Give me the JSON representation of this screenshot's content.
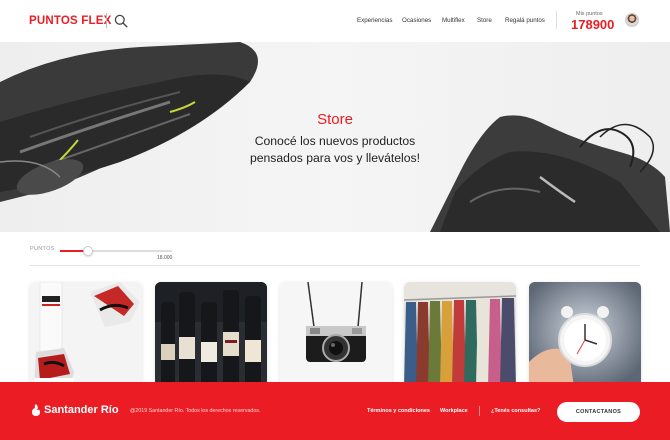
{
  "header": {
    "logo": "PUNTOS FLEX",
    "nav": [
      "Experiencias",
      "Ocasiones",
      "Multiflex",
      "Store",
      "Regalá puntos"
    ],
    "points_label": "Mis puntos",
    "points_value": "178900"
  },
  "hero": {
    "title": "Store",
    "subtitle": "Conocé los nuevos productos pensados para vos y llevátelos!"
  },
  "filter": {
    "label": "PUNTOS",
    "max_value": "18.000",
    "slider_level": 0.25
  },
  "cards": [
    {
      "name": "sneakers"
    },
    {
      "name": "wine"
    },
    {
      "name": "camera"
    },
    {
      "name": "clothing"
    },
    {
      "name": "clock"
    }
  ],
  "footer": {
    "brand": "Santander Río",
    "copyright": "@2019 Santander Río. Todos los derechos reservados.",
    "links": [
      "Términos y condiciones",
      "Workplace",
      "¿Tenés consultas?"
    ],
    "contact_button": "CONTACTANOS"
  },
  "colors": {
    "brand_red": "#ec1c24"
  }
}
